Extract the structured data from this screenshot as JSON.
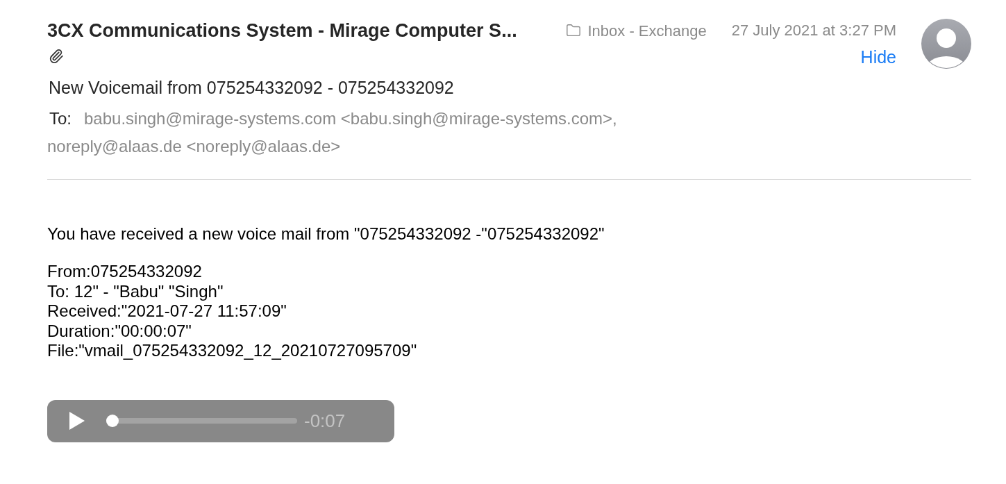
{
  "header": {
    "sender": "3CX Communications System - Mirage Computer S...",
    "has_attachment": true,
    "folder": "Inbox - Exchange",
    "date": "27 July 2021 at 3:27 PM",
    "hide_link": "Hide"
  },
  "subject": "New Voicemail from 075254332092 - 075254332092",
  "to": {
    "label": "To:",
    "recipients": [
      "babu.singh@mirage-systems.com <babu.singh@mirage-systems.com>,",
      "noreply@alaas.de <noreply@alaas.de>"
    ]
  },
  "body": {
    "intro": "You have received a new voice mail from \"075254332092 -\"075254332092\"",
    "details": [
      "From:075254332092",
      "To: 12\" - \"Babu\" \"Singh\"",
      "Received:\"2021-07-27 11:57:09\"",
      "Duration:\"00:00:07\"",
      "File:\"vmail_075254332092_12_20210727095709\""
    ]
  },
  "audio_player": {
    "playing": false,
    "level": 0,
    "remaining": "-0:07"
  }
}
